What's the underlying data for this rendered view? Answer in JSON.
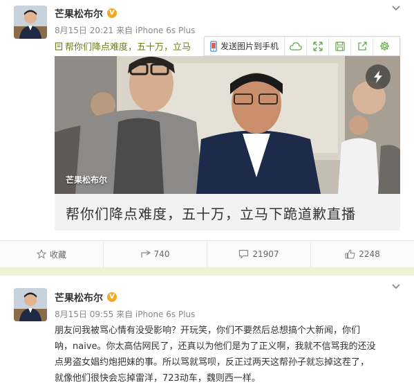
{
  "post1": {
    "username": "芒果松布尔",
    "verified_badge": "V",
    "meta": "8月15日 20:21 来自 iPhone 6s Plus",
    "text": "帮你们降点难度，五十万，立马",
    "toolbar": {
      "send_label": "发送图片到手机",
      "icons": [
        "cloud-icon",
        "fullscreen-icon",
        "save-icon",
        "external-link-icon",
        "gear-icon"
      ]
    },
    "media": {
      "author_watermark": "芒果松布尔",
      "caption": "帮你们降点难度，五十万，立马下跪道歉直播"
    },
    "actions": {
      "favorite": "收藏",
      "comment_count": "740",
      "repost_count": "21907",
      "like_count": "2248"
    }
  },
  "post2": {
    "username": "芒果松布尔",
    "verified_badge": "V",
    "meta": "8月15日 09:55 来自 iPhone 6s Plus",
    "text_lines": [
      "朋友问我被骂心情有没受影响？开玩笑，你们不要然后总想搞个大新闻，你们",
      "呐，naive。你太高估网民了，还真以为他们是为了正义啊，我就不信骂我的还没",
      "点男盗女娼约炮把妹的事。所以骂就骂呗，反正过两天这帮孙子就忘掉这茬了，",
      "就像他们很快会忘掉雷洋，723动车，魏则西一样。"
    ]
  },
  "colors": {
    "accent_green": "#6b7f1a",
    "badge_orange": "#f5a623",
    "page_background": "#eef0d8"
  }
}
